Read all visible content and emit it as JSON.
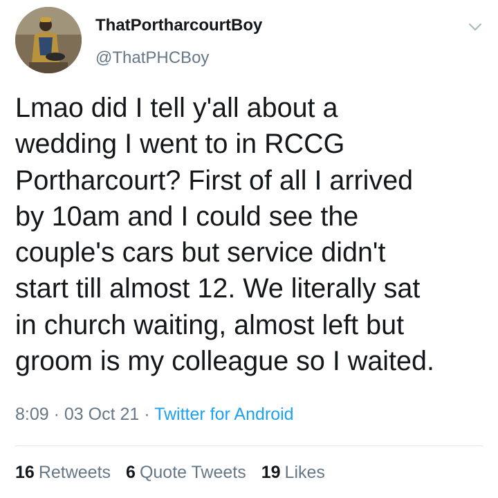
{
  "user": {
    "display_name": "ThatPortharcourtBoy",
    "handle": "@ThatPHCBoy"
  },
  "tweet": {
    "text": "Lmao did I tell y'all about a\nwedding I went to in RCCG\nPortharcourt? First of all I arrived\nby 10am and I could see the\ncouple's cars but service didn't\nstart till almost 12. We literally sat\nin church waiting, almost left but\ngroom is my colleague so I waited."
  },
  "meta": {
    "time": "8:09",
    "separator": "·",
    "date": "03 Oct 21",
    "source": "Twitter for Android"
  },
  "stats": {
    "retweets_count": "16",
    "retweets_label": "Retweets",
    "quotes_count": "6",
    "quotes_label": "Quote Tweets",
    "likes_count": "19",
    "likes_label": "Likes"
  },
  "icons": {
    "caret": "chevron-down-icon",
    "avatar": "profile-photo"
  },
  "colors": {
    "text": "#14171a",
    "secondary": "#657786",
    "link": "#1da1f2",
    "divider": "#e1e8ed"
  }
}
